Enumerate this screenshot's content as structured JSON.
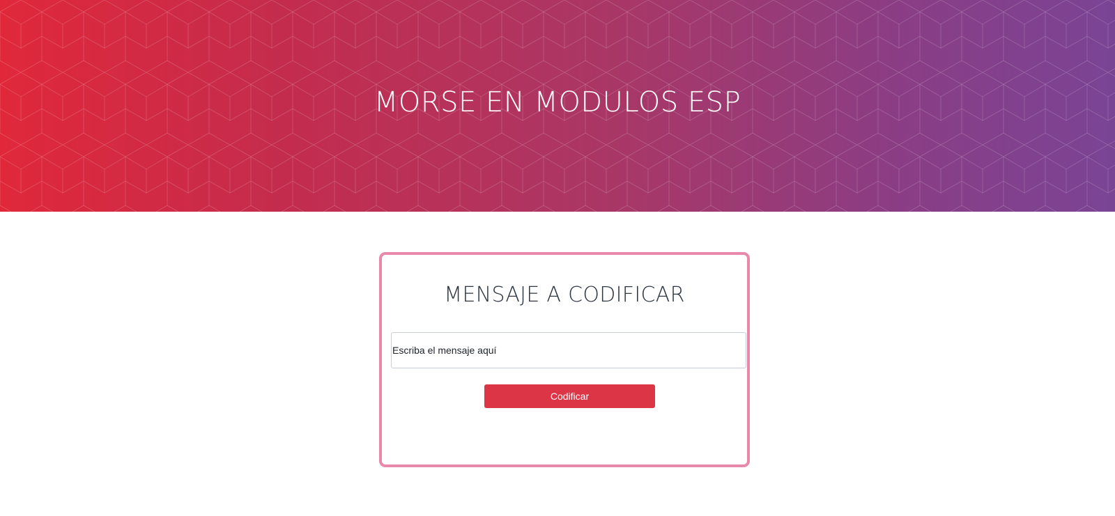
{
  "header": {
    "title": "MORSE EN MODULOS ESP",
    "gradient_start": "#e0283a",
    "gradient_end": "#7a4495",
    "pattern": "isometric-cubes"
  },
  "card": {
    "title": "MENSAJE A CODIFICAR",
    "border_color": "#e889ab",
    "message_input": {
      "value": "",
      "placeholder": "Escriba el mensaje aquí"
    },
    "encode_button": {
      "label": "Codificar",
      "color": "#dc3545"
    }
  }
}
